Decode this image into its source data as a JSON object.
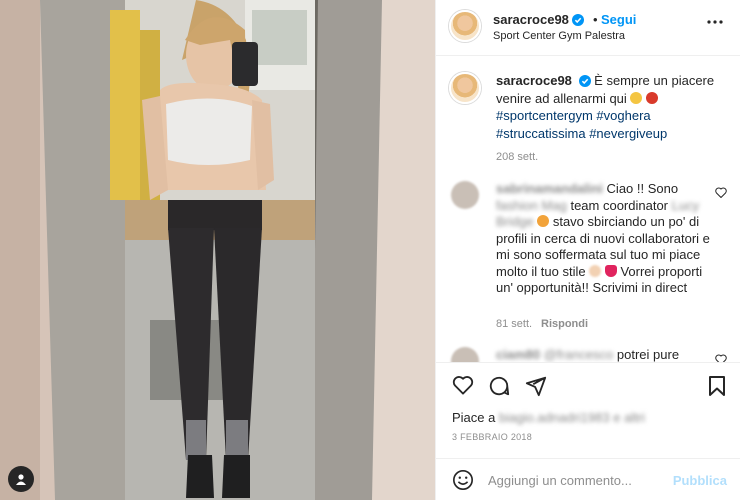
{
  "post": {
    "username": "saracroce98",
    "follow_label": "Segui",
    "dot": "•",
    "location": "Sport Center Gym Palestra",
    "more_icon": "more-horizontal-icon"
  },
  "caption": {
    "username": "saracroce98",
    "text": "È sempre un piacere venire ad allenarmi qui",
    "hashtags": "#sportcentergym #voghera #struccatissima #nevergiveup",
    "time": "208 sett."
  },
  "comments": [
    {
      "username": "sabrinamandalini",
      "text_a": "Ciao !! Sono",
      "text_b": "fashion Mag",
      "text_c": "team coordinator",
      "text_d": "Lucy Bridge",
      "text_e": "stavo sbirciando un po' di profili in cerca di nuovi collaboratori e mi sono soffermata sul tuo mi piace molto il tuo stile",
      "text_f": "Vorrei proporti un' opportunità!! Scrivimi in direct",
      "time": "81 sett.",
      "reply_label": "Rispondi"
    },
    {
      "username": "ciam80",
      "mention": "@francesco",
      "text": "potrei pure"
    }
  ],
  "actions": {
    "like_icon": "heart-icon",
    "comment_icon": "comment-icon",
    "share_icon": "share-icon",
    "save_icon": "bookmark-icon"
  },
  "likes": {
    "prefix": "Piace a",
    "blurred_user": "biagio.adnadri1983",
    "blurred_suffix": "e altri"
  },
  "date": "3 FEBBRAIO 2018",
  "comment_box": {
    "placeholder": "Aggiungi un commento...",
    "publish_label": "Pubblica"
  },
  "colors": {
    "accent": "#0095f6",
    "link": "#00376b",
    "muted": "#8e8e8e",
    "publish_disabled": "#b2dffc"
  }
}
